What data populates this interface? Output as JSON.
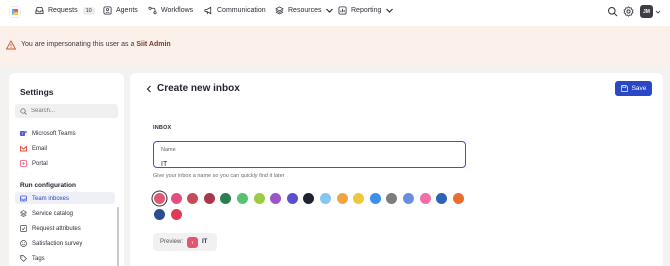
{
  "nav": {
    "items": [
      {
        "label": "Requests",
        "count": "10",
        "icon": "inbox-icon"
      },
      {
        "label": "Agents",
        "icon": "agents-icon"
      },
      {
        "label": "Workflows",
        "icon": "workflows-icon"
      },
      {
        "label": "Communication",
        "icon": "megaphone-icon"
      },
      {
        "label": "Resources",
        "icon": "layers-icon"
      },
      {
        "label": "Reporting",
        "icon": "chart-icon"
      }
    ],
    "avatar_initials": "JM"
  },
  "banner": {
    "text": "You are impersonating this user as a",
    "role": "Siit Admin"
  },
  "sidebar": {
    "title": "Settings",
    "search_placeholder": "Search...",
    "items": [
      {
        "label": "Microsoft Teams",
        "icon": "teams-icon"
      },
      {
        "label": "Email",
        "icon": "gmail-icon"
      },
      {
        "label": "Portal",
        "icon": "portal-icon"
      }
    ],
    "section": "Run configuration",
    "config_items": [
      {
        "label": "Team inboxes",
        "icon": "inbox-icon",
        "active": true
      },
      {
        "label": "Service catalog",
        "icon": "stack-icon"
      },
      {
        "label": "Request attributes",
        "icon": "checkbox-icon"
      },
      {
        "label": "Satisfaction survey",
        "icon": "smile-icon"
      },
      {
        "label": "Tags",
        "icon": "tag-icon"
      }
    ]
  },
  "main": {
    "title": "Create new inbox",
    "save_label": "Save",
    "section_label": "INBOX",
    "name_label": "Name",
    "name_value": "IT",
    "helper": "Give your inbox a name so you can quickly find it later",
    "colors": [
      "#e0586f",
      "#e34e80",
      "#c84a56",
      "#a8384c",
      "#2e7d4f",
      "#57c26f",
      "#9ccc45",
      "#9a55c8",
      "#5b4fd1",
      "#1f2230",
      "#84c6ef",
      "#f1a444",
      "#f0c63a",
      "#3d8fe8",
      "#7d7d7d",
      "#6b8fe0",
      "#ef6fa8",
      "#2f63b5",
      "#eb6e2e",
      "#2d4c8f",
      "#e23a55"
    ],
    "selected_color": "#e0586f",
    "preview_label": "Preview:",
    "preview_badge": "I",
    "preview_name": "IT"
  }
}
